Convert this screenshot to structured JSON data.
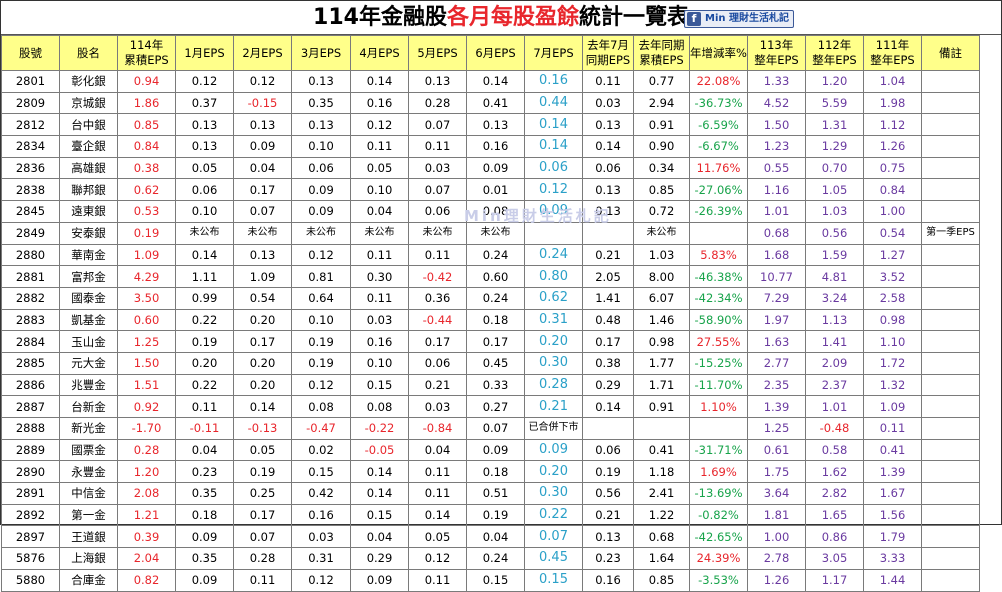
{
  "title": {
    "part1": "114年金融股",
    "part2": "各月每股盈餘",
    "part3": "統計一覽表"
  },
  "badge": {
    "icon": "f",
    "text": "Min 理財生活札記"
  },
  "watermark": "Min理財生活札記",
  "headers": {
    "code": "股號",
    "name": "股名",
    "cum_1": "114年",
    "cum_2": "累積EPS",
    "m1": "1月EPS",
    "m2": "2月EPS",
    "m3": "3月EPS",
    "m4": "4月EPS",
    "m5": "5月EPS",
    "m6": "6月EPS",
    "m7": "7月EPS",
    "ly_jul_1": "去年7月",
    "ly_jul_2": "同期EPS",
    "ly_cum_1": "去年同期",
    "ly_cum_2": "累積EPS",
    "yoy": "年增減率%",
    "y113_1": "113年",
    "y113_2": "整年EPS",
    "y112_1": "112年",
    "y112_2": "整年EPS",
    "y111_1": "111年",
    "y111_2": "整年EPS",
    "note": "備註"
  },
  "colors": {
    "header_bg": "#ffff8a",
    "red": "#e8262c",
    "cyan": "#2aa0c8",
    "green": "#17a34a",
    "purple": "#6a3aa0"
  },
  "rows": [
    {
      "code": "2801",
      "name": "彰化銀",
      "cum": "0.94",
      "m1": "0.12",
      "m2": "0.12",
      "m3": "0.13",
      "m4": "0.14",
      "m5": "0.13",
      "m6": "0.14",
      "m7": "0.16",
      "ly_jul": "0.11",
      "ly_cum": "0.77",
      "yoy": "22.08%",
      "y113": "1.33",
      "y112": "1.20",
      "y111": "1.04",
      "note": ""
    },
    {
      "code": "2809",
      "name": "京城銀",
      "cum": "1.86",
      "m1": "0.37",
      "m2": "-0.15",
      "m3": "0.35",
      "m4": "0.16",
      "m5": "0.28",
      "m6": "0.41",
      "m7": "0.44",
      "ly_jul": "0.03",
      "ly_cum": "2.94",
      "yoy": "-36.73%",
      "y113": "4.52",
      "y112": "5.59",
      "y111": "1.98",
      "note": ""
    },
    {
      "code": "2812",
      "name": "台中銀",
      "cum": "0.85",
      "m1": "0.13",
      "m2": "0.13",
      "m3": "0.13",
      "m4": "0.12",
      "m5": "0.07",
      "m6": "0.13",
      "m7": "0.14",
      "ly_jul": "0.13",
      "ly_cum": "0.91",
      "yoy": "-6.59%",
      "y113": "1.50",
      "y112": "1.31",
      "y111": "1.12",
      "note": ""
    },
    {
      "code": "2834",
      "name": "臺企銀",
      "cum": "0.84",
      "m1": "0.13",
      "m2": "0.09",
      "m3": "0.10",
      "m4": "0.11",
      "m5": "0.11",
      "m6": "0.16",
      "m7": "0.14",
      "ly_jul": "0.14",
      "ly_cum": "0.90",
      "yoy": "-6.67%",
      "y113": "1.23",
      "y112": "1.29",
      "y111": "1.26",
      "note": ""
    },
    {
      "code": "2836",
      "name": "高雄銀",
      "cum": "0.38",
      "m1": "0.05",
      "m2": "0.04",
      "m3": "0.06",
      "m4": "0.05",
      "m5": "0.03",
      "m6": "0.09",
      "m7": "0.06",
      "ly_jul": "0.06",
      "ly_cum": "0.34",
      "yoy": "11.76%",
      "y113": "0.55",
      "y112": "0.70",
      "y111": "0.75",
      "note": ""
    },
    {
      "code": "2838",
      "name": "聯邦銀",
      "cum": "0.62",
      "m1": "0.06",
      "m2": "0.17",
      "m3": "0.09",
      "m4": "0.10",
      "m5": "0.07",
      "m6": "0.01",
      "m7": "0.12",
      "ly_jul": "0.13",
      "ly_cum": "0.85",
      "yoy": "-27.06%",
      "y113": "1.16",
      "y112": "1.05",
      "y111": "0.84",
      "note": ""
    },
    {
      "code": "2845",
      "name": "遠東銀",
      "cum": "0.53",
      "m1": "0.10",
      "m2": "0.07",
      "m3": "0.09",
      "m4": "0.04",
      "m5": "0.06",
      "m6": "0.08",
      "m7": "0.09",
      "ly_jul": "0.13",
      "ly_cum": "0.72",
      "yoy": "-26.39%",
      "y113": "1.01",
      "y112": "1.03",
      "y111": "1.00",
      "note": ""
    },
    {
      "code": "2849",
      "name": "安泰銀",
      "cum": "0.19",
      "m1": "未公布",
      "m2": "未公布",
      "m3": "未公布",
      "m4": "未公布",
      "m5": "未公布",
      "m6": "未公布",
      "m7": "",
      "ly_jul": "",
      "ly_cum": "未公布",
      "yoy": "",
      "y113": "0.68",
      "y112": "0.56",
      "y111": "0.54",
      "note": "第一季EPS"
    },
    {
      "code": "2880",
      "name": "華南金",
      "cum": "1.09",
      "m1": "0.14",
      "m2": "0.13",
      "m3": "0.12",
      "m4": "0.11",
      "m5": "0.11",
      "m6": "0.24",
      "m7": "0.24",
      "ly_jul": "0.21",
      "ly_cum": "1.03",
      "yoy": "5.83%",
      "y113": "1.68",
      "y112": "1.59",
      "y111": "1.27",
      "note": ""
    },
    {
      "code": "2881",
      "name": "富邦金",
      "cum": "4.29",
      "m1": "1.11",
      "m2": "1.09",
      "m3": "0.81",
      "m4": "0.30",
      "m5": "-0.42",
      "m6": "0.60",
      "m7": "0.80",
      "ly_jul": "2.05",
      "ly_cum": "8.00",
      "yoy": "-46.38%",
      "y113": "10.77",
      "y112": "4.81",
      "y111": "3.52",
      "note": ""
    },
    {
      "code": "2882",
      "name": "國泰金",
      "cum": "3.50",
      "m1": "0.99",
      "m2": "0.54",
      "m3": "0.64",
      "m4": "0.11",
      "m5": "0.36",
      "m6": "0.24",
      "m7": "0.62",
      "ly_jul": "1.41",
      "ly_cum": "6.07",
      "yoy": "-42.34%",
      "y113": "7.29",
      "y112": "3.24",
      "y111": "2.58",
      "note": ""
    },
    {
      "code": "2883",
      "name": "凱基金",
      "cum": "0.60",
      "m1": "0.22",
      "m2": "0.20",
      "m3": "0.10",
      "m4": "0.03",
      "m5": "-0.44",
      "m6": "0.18",
      "m7": "0.31",
      "ly_jul": "0.48",
      "ly_cum": "1.46",
      "yoy": "-58.90%",
      "y113": "1.97",
      "y112": "1.13",
      "y111": "0.98",
      "note": ""
    },
    {
      "code": "2884",
      "name": "玉山金",
      "cum": "1.25",
      "m1": "0.19",
      "m2": "0.17",
      "m3": "0.19",
      "m4": "0.16",
      "m5": "0.17",
      "m6": "0.17",
      "m7": "0.20",
      "ly_jul": "0.17",
      "ly_cum": "0.98",
      "yoy": "27.55%",
      "y113": "1.63",
      "y112": "1.41",
      "y111": "1.10",
      "note": ""
    },
    {
      "code": "2885",
      "name": "元大金",
      "cum": "1.50",
      "m1": "0.20",
      "m2": "0.20",
      "m3": "0.19",
      "m4": "0.10",
      "m5": "0.06",
      "m6": "0.45",
      "m7": "0.30",
      "ly_jul": "0.38",
      "ly_cum": "1.77",
      "yoy": "-15.25%",
      "y113": "2.77",
      "y112": "2.09",
      "y111": "1.72",
      "note": ""
    },
    {
      "code": "2886",
      "name": "兆豐金",
      "cum": "1.51",
      "m1": "0.22",
      "m2": "0.20",
      "m3": "0.12",
      "m4": "0.15",
      "m5": "0.21",
      "m6": "0.33",
      "m7": "0.28",
      "ly_jul": "0.29",
      "ly_cum": "1.71",
      "yoy": "-11.70%",
      "y113": "2.35",
      "y112": "2.37",
      "y111": "1.32",
      "note": ""
    },
    {
      "code": "2887",
      "name": "台新金",
      "cum": "0.92",
      "m1": "0.11",
      "m2": "0.14",
      "m3": "0.08",
      "m4": "0.08",
      "m5": "0.03",
      "m6": "0.27",
      "m7": "0.21",
      "ly_jul": "0.14",
      "ly_cum": "0.91",
      "yoy": "1.10%",
      "y113": "1.39",
      "y112": "1.01",
      "y111": "1.09",
      "note": ""
    },
    {
      "code": "2888",
      "name": "新光金",
      "cum": "-1.70",
      "m1": "-0.11",
      "m2": "-0.13",
      "m3": "-0.47",
      "m4": "-0.22",
      "m5": "-0.84",
      "m6": "0.07",
      "m7": "已合併下市",
      "ly_jul": "",
      "ly_cum": "",
      "yoy": "",
      "y113": "1.25",
      "y112": "-0.48",
      "y111": "0.11",
      "note": ""
    },
    {
      "code": "2889",
      "name": "國票金",
      "cum": "0.28",
      "m1": "0.04",
      "m2": "0.05",
      "m3": "0.02",
      "m4": "-0.05",
      "m5": "0.04",
      "m6": "0.09",
      "m7": "0.09",
      "ly_jul": "0.06",
      "ly_cum": "0.41",
      "yoy": "-31.71%",
      "y113": "0.61",
      "y112": "0.58",
      "y111": "0.41",
      "note": ""
    },
    {
      "code": "2890",
      "name": "永豐金",
      "cum": "1.20",
      "m1": "0.23",
      "m2": "0.19",
      "m3": "0.15",
      "m4": "0.14",
      "m5": "0.11",
      "m6": "0.18",
      "m7": "0.20",
      "ly_jul": "0.19",
      "ly_cum": "1.18",
      "yoy": "1.69%",
      "y113": "1.75",
      "y112": "1.62",
      "y111": "1.39",
      "note": ""
    },
    {
      "code": "2891",
      "name": "中信金",
      "cum": "2.08",
      "m1": "0.35",
      "m2": "0.25",
      "m3": "0.42",
      "m4": "0.14",
      "m5": "0.11",
      "m6": "0.51",
      "m7": "0.30",
      "ly_jul": "0.56",
      "ly_cum": "2.41",
      "yoy": "-13.69%",
      "y113": "3.64",
      "y112": "2.82",
      "y111": "1.67",
      "note": ""
    },
    {
      "code": "2892",
      "name": "第一金",
      "cum": "1.21",
      "m1": "0.18",
      "m2": "0.17",
      "m3": "0.16",
      "m4": "0.15",
      "m5": "0.14",
      "m6": "0.19",
      "m7": "0.22",
      "ly_jul": "0.21",
      "ly_cum": "1.22",
      "yoy": "-0.82%",
      "y113": "1.81",
      "y112": "1.65",
      "y111": "1.56",
      "note": ""
    },
    {
      "code": "2897",
      "name": "王道銀",
      "cum": "0.39",
      "m1": "0.09",
      "m2": "0.07",
      "m3": "0.03",
      "m4": "0.04",
      "m5": "0.05",
      "m6": "0.04",
      "m7": "0.07",
      "ly_jul": "0.13",
      "ly_cum": "0.68",
      "yoy": "-42.65%",
      "y113": "1.00",
      "y112": "0.86",
      "y111": "1.79",
      "note": ""
    },
    {
      "code": "5876",
      "name": "上海銀",
      "cum": "2.04",
      "m1": "0.35",
      "m2": "0.28",
      "m3": "0.31",
      "m4": "0.29",
      "m5": "0.12",
      "m6": "0.24",
      "m7": "0.45",
      "ly_jul": "0.23",
      "ly_cum": "1.64",
      "yoy": "24.39%",
      "y113": "2.78",
      "y112": "3.05",
      "y111": "3.33",
      "note": ""
    },
    {
      "code": "5880",
      "name": "合庫金",
      "cum": "0.82",
      "m1": "0.09",
      "m2": "0.11",
      "m3": "0.12",
      "m4": "0.09",
      "m5": "0.11",
      "m6": "0.15",
      "m7": "0.15",
      "ly_jul": "0.16",
      "ly_cum": "0.85",
      "yoy": "-3.53%",
      "y113": "1.26",
      "y112": "1.17",
      "y111": "1.44",
      "note": ""
    }
  ]
}
